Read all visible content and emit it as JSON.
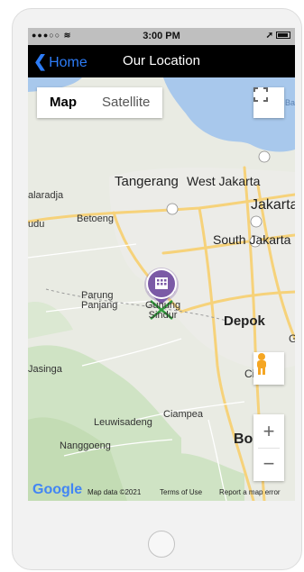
{
  "status_bar": {
    "signal": "●●●○○",
    "wifi": "≋",
    "time": "3:00 PM",
    "location": "➚"
  },
  "nav": {
    "back_label": "Home",
    "title": "Our Location"
  },
  "map_controls": {
    "map_label": "Map",
    "satellite_label": "Satellite",
    "zoom_in": "+",
    "zoom_out": "−"
  },
  "place_labels": {
    "tangerang": "Tangerang",
    "west_jakarta": "West Jakarta",
    "jakarta": "Jakarta",
    "south_jakarta": "South Jakarta",
    "balaradja": "alaradja",
    "betoeng": "Betoeng",
    "udu": "udu",
    "parung_panjang": [
      "Parung",
      "Panjang"
    ],
    "gunung_sindur": [
      "Gunung",
      "Sindur"
    ],
    "depok": "Depok",
    "jasinga": "Jasinga",
    "ci": "Ci",
    "ciampea": "Ciampea",
    "leuwisadeng": "Leuwisadeng",
    "nanggoeng": "Nanggoeng",
    "bog": "Bog",
    "g": "G",
    "ba": "Ba"
  },
  "footer": {
    "logo": "Google",
    "map_data": "Map data ©2021",
    "terms": "Terms of Use",
    "report": "Report a map error"
  },
  "colors": {
    "nav_bg": "#000000",
    "back_blue": "#2d7cf6",
    "marker": "#7b5aa6",
    "water": "#a8c8ec",
    "road": "#f6d27a"
  }
}
